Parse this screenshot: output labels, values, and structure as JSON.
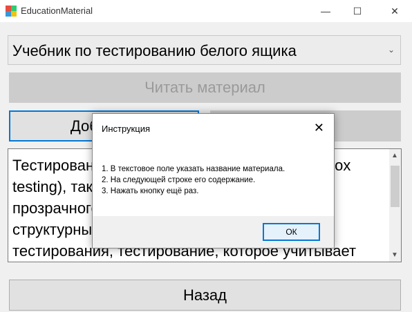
{
  "window": {
    "title": "EducationMaterial",
    "minimize_glyph": "—",
    "maximize_glyph": "☐",
    "close_glyph": "✕"
  },
  "material_select": {
    "selected": "Учебник по тестированию белого ящика",
    "arrow_icon": "chevron-down-icon"
  },
  "buttons": {
    "read": "Читать материал",
    "add": "Добавить",
    "right": "",
    "back": "Назад"
  },
  "content_text": "Тестирование методом белого ящика (white box testing), также называемое тестированием прозрачного ящика (англ. glass box testing), структурным тестированием — это метод тестирования, тестирование, которое учитывает внутренние",
  "dialog": {
    "title": "Инструкция",
    "lines": [
      "1. В текстовое поле указать название материала.",
      "2. На следующей строке его содержание.",
      "3. Нажать кнопку ещё раз."
    ],
    "ok_label": "ОК"
  }
}
